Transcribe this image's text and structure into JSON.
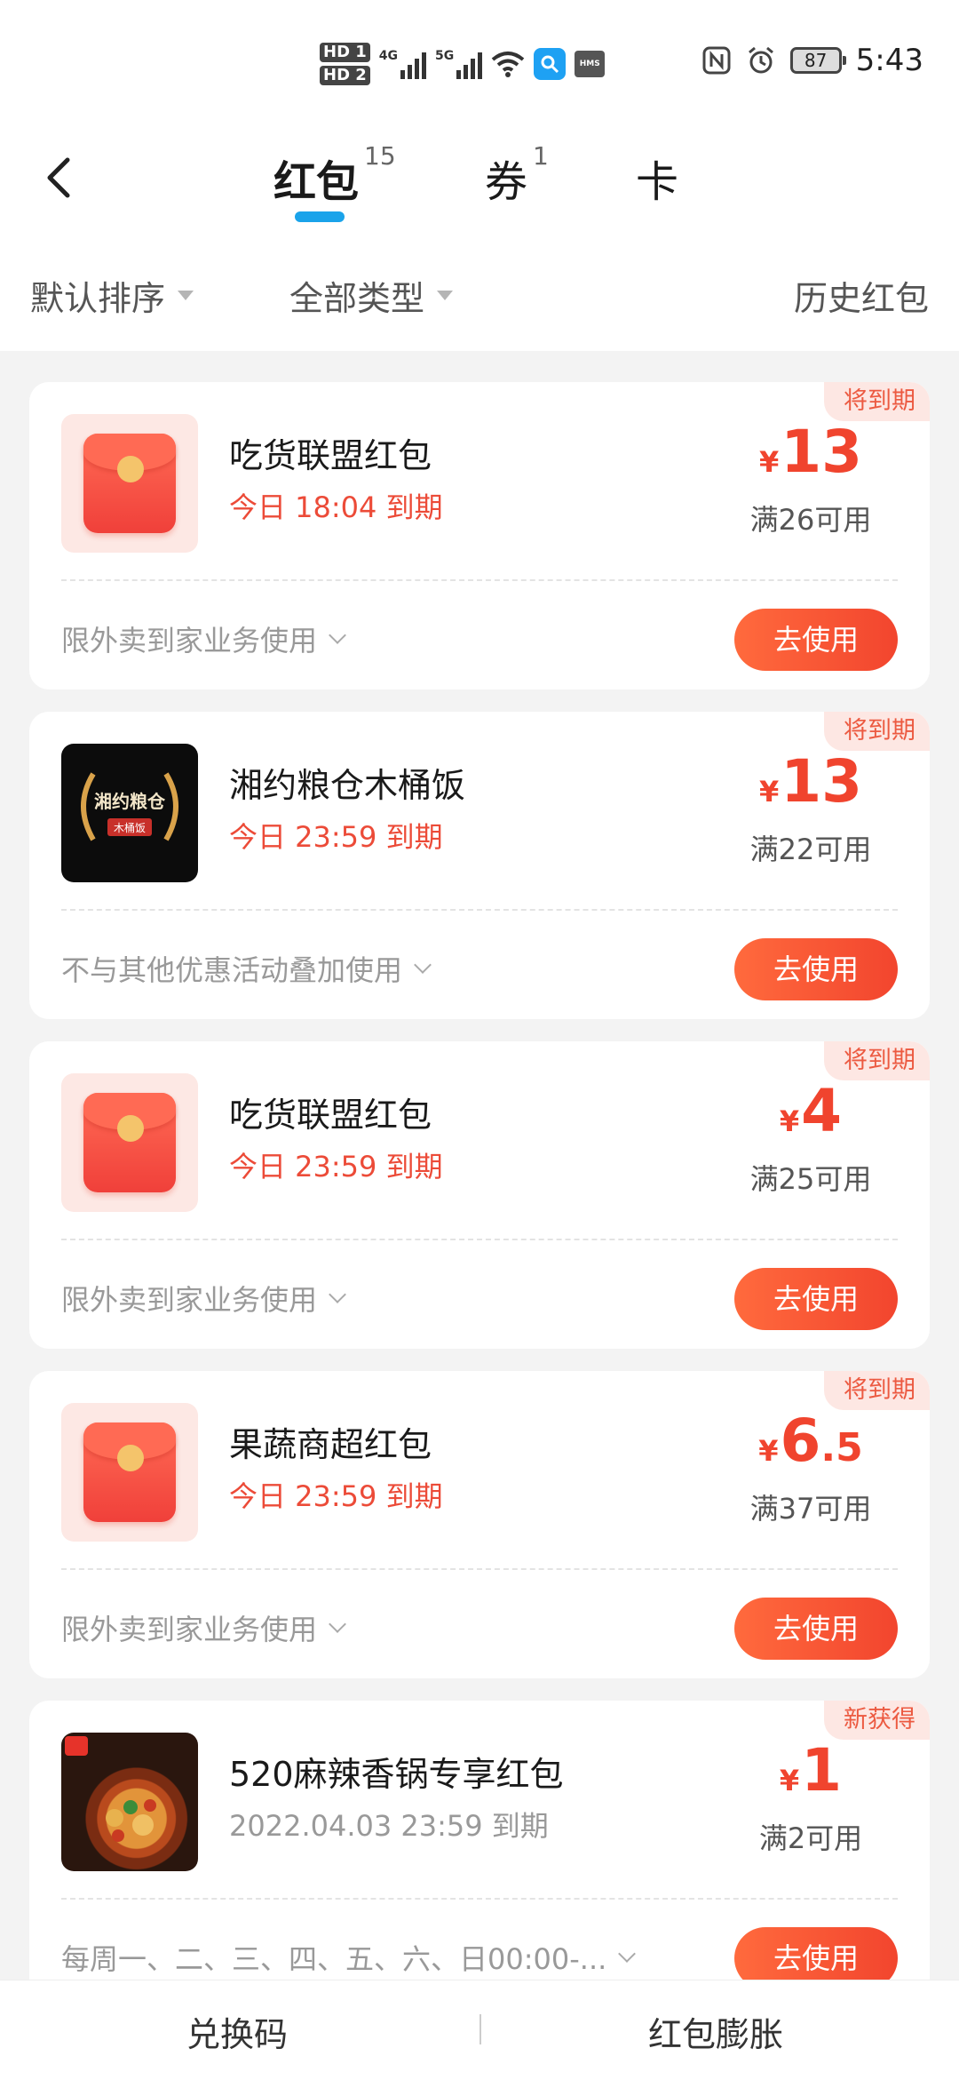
{
  "status_bar": {
    "hd1": "HD 1",
    "hd2": "HD 2",
    "net1": "4G",
    "net2": "5G",
    "hms": "HMS",
    "battery": "87",
    "time": "5:43"
  },
  "tabs": [
    {
      "label": "红包",
      "count": "15"
    },
    {
      "label": "券",
      "count": "1"
    },
    {
      "label": "卡",
      "count": ""
    }
  ],
  "filters": {
    "sort": "默认排序",
    "type": "全部类型",
    "history": "历史红包"
  },
  "cards": [
    {
      "tag": "将到期",
      "name": "吃货联盟红包",
      "expire": "今日 18:04 到期",
      "amount_int": "13",
      "amount_dec": "",
      "currency": "¥",
      "condition": "满26可用",
      "rule": "限外卖到家业务使用",
      "button": "去使用",
      "thumb": "red-envelope-icon"
    },
    {
      "tag": "将到期",
      "name": "湘约粮仓木桶饭",
      "expire": "今日 23:59 到期",
      "amount_int": "13",
      "amount_dec": "",
      "currency": "¥",
      "condition": "满22可用",
      "rule": "不与其他优惠活动叠加使用",
      "button": "去使用",
      "thumb": "store-logo",
      "logo_text": "湘约粮仓",
      "logo_sub": "木桶饭"
    },
    {
      "tag": "将到期",
      "name": "吃货联盟红包",
      "expire": "今日 23:59 到期",
      "amount_int": "4",
      "amount_dec": "",
      "currency": "¥",
      "condition": "满25可用",
      "rule": "限外卖到家业务使用",
      "button": "去使用",
      "thumb": "red-envelope-icon"
    },
    {
      "tag": "将到期",
      "name": "果蔬商超红包",
      "expire": "今日 23:59 到期",
      "amount_int": "6",
      "amount_dec": ".5",
      "currency": "¥",
      "condition": "满37可用",
      "rule": "限外卖到家业务使用",
      "button": "去使用",
      "thumb": "red-envelope-icon"
    },
    {
      "tag": "新获得",
      "name": "520麻辣香锅专享红包",
      "expire": "2022.04.03 23:59 到期",
      "amount_int": "1",
      "amount_dec": "",
      "currency": "¥",
      "condition": "满2可用",
      "rule": "每周一、二、三、四、五、六、日00:00-...",
      "button": "去使用",
      "thumb": "food-photo"
    }
  ],
  "bottom": {
    "left": "兑换码",
    "right": "红包膨胀"
  },
  "colors": {
    "accent": "#f0442e",
    "tab_indicator": "#1aa3ea",
    "tag_bg": "#fde7e3"
  }
}
